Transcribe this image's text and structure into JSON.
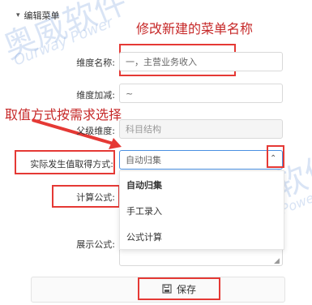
{
  "section": {
    "title": "编辑菜单",
    "toggle_icon": "chevron-down-icon"
  },
  "form": {
    "dimension_name": {
      "label": "维度名称:",
      "value": "一，主营业务收入"
    },
    "dimension_sign": {
      "label": "维度加减:",
      "value": "~"
    },
    "parent_dimension": {
      "label": "父级维度:",
      "value": "科目结构"
    },
    "value_method": {
      "label": "实际发生值取得方式:",
      "value": "自动归集"
    },
    "calc_formula": {
      "label": "计算公式:"
    },
    "display_formula": {
      "label": "展示公式:"
    }
  },
  "dropdown": {
    "options": [
      "自动归集",
      "手工录入",
      "公式计算"
    ],
    "selected": "自动归集"
  },
  "save": {
    "label": "保存",
    "icon": "save-icon"
  },
  "annotations": {
    "rename_note": "修改新建的菜单名称",
    "method_note": "取值方式按需求选择"
  },
  "watermark": {
    "cn": "奥威软件",
    "en": "Ourway Power"
  },
  "colors": {
    "annotation_red": "#e53935",
    "focus_blue": "#4a90e2",
    "watermark_blue": "#5082d2"
  }
}
